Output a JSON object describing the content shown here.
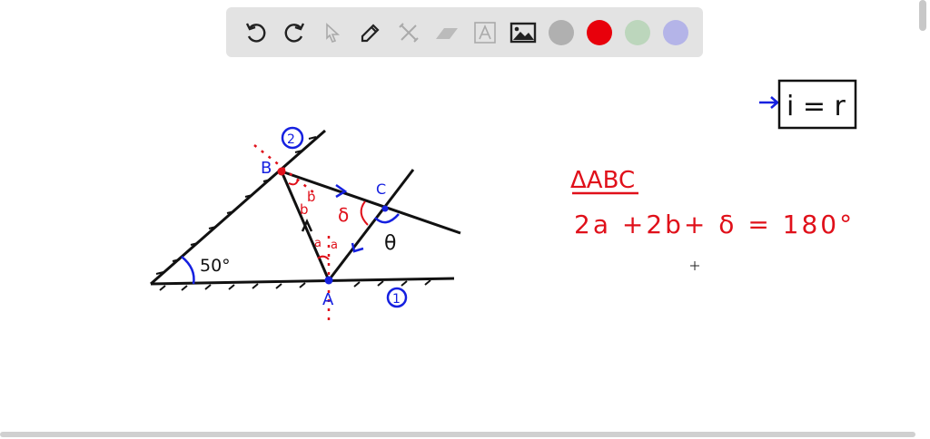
{
  "toolbar": {
    "tools": [
      "undo-icon",
      "redo-icon",
      "select-icon",
      "pen-icon",
      "tools-icon",
      "eraser-icon",
      "text-icon",
      "image-icon"
    ],
    "colors": {
      "gray": "#b0b0b0",
      "red": "#e8000b",
      "green": "#bcd6bc",
      "purple": "#b4b4e8"
    }
  },
  "drawing": {
    "label_B": "B",
    "label_A": "A",
    "label_C": "C",
    "label_mirror1": "1",
    "label_mirror2": "2",
    "angle_50": "50°",
    "angle_b1": "b",
    "angle_b2": "b",
    "angle_a1": "a",
    "angle_a2": "a",
    "delta": "δ",
    "theta": "θ"
  },
  "notes": {
    "triangle_label": "ΔABC",
    "equation": "2a +2b+ δ = 180°",
    "law": "i = r"
  }
}
